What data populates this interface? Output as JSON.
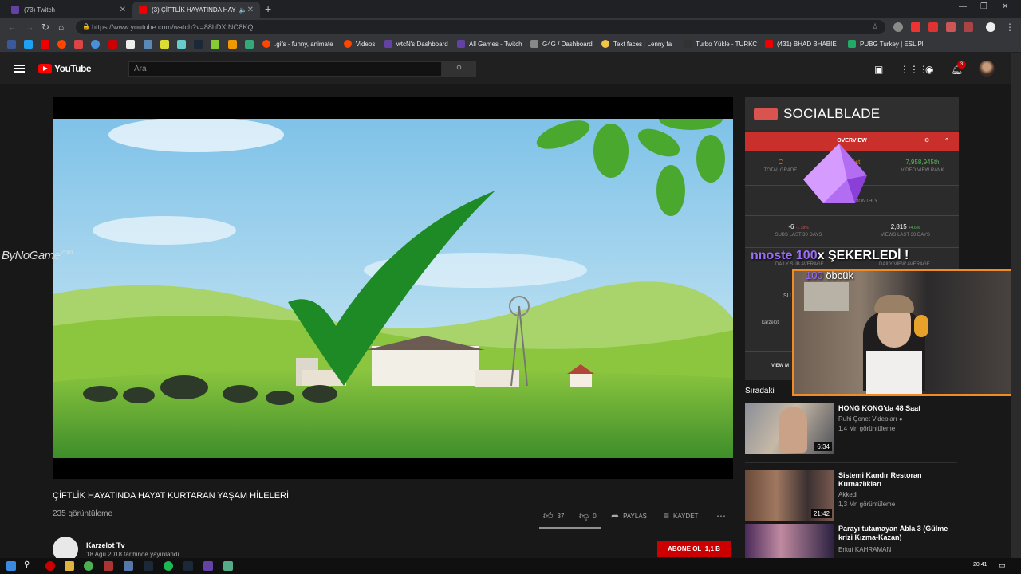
{
  "browser": {
    "tabs": [
      {
        "label": "(73) Twitch"
      },
      {
        "label": "(3) ÇİFTLİK HAYATINDA HAY"
      }
    ],
    "url": "https://www.youtube.com/watch?v=88hDXtNO8KQ",
    "bookmarks": [
      ".gifs - funny, animate",
      "Videos",
      "wtcN's Dashboard",
      "All Games - Twitch",
      "G4G / Dashboard",
      "Text faces | Lenny fa",
      "Turbo Yükle - TURKC",
      "(431) BHAD BHABIE",
      "PUBG Turkey | ESL Pl"
    ]
  },
  "youtube": {
    "logo_text": "YouTube",
    "search_placeholder": "Ara",
    "notifications_count": "3"
  },
  "watermark": "ByNoGame",
  "watermark_sup": ".com",
  "video": {
    "title": "ÇİFTLİK HAYATINDA HAYAT KURTARAN YAŞAM HİLELERİ",
    "views": "235 görüntüleme",
    "likes": "37",
    "dislikes": "0",
    "share_label": "PAYLAŞ",
    "save_label": "KAYDET",
    "channel_name": "Karzelot Tv",
    "published": "18 Ağu 2018 tarihinde yayınlandı",
    "subscribe_label": "ABONE OL",
    "subscriber_count": "1,1 B"
  },
  "socialblade": {
    "title": "SOCIALBLADE",
    "tab": "OVERVIEW",
    "stats": [
      {
        "value": "C",
        "label": "TOTAL GRADE"
      },
      {
        "value": "...91st",
        "label": "...RANK"
      },
      {
        "value": "7,958,945th",
        "label": "VIDEO VIEW RANK"
      }
    ],
    "estimated_label": "ESTIMATED MONTHLY",
    "subs_30": {
      "value": "-6",
      "change": "-1.18%",
      "label": "SUBS LAST 30 DAYS"
    },
    "views_30": {
      "value": "2,815",
      "change": "+4.6%",
      "label": "VIEWS LAST 30 DAYS"
    },
    "daily_sub_avg": "DAILY SUB AVERAGE",
    "daily_view_avg": "DAILY VIEW AVERAGE",
    "partial_label": "SU",
    "user_label": "karzelot",
    "view_more": "VIEW M"
  },
  "overlay": {
    "ticker_user": "nnoste",
    "ticker_amount": "100",
    "ticker_text": "x ŞEKERLEDİ !",
    "ticker2_amount": "100",
    "ticker2_text": "öbcük"
  },
  "upnext": {
    "label": "Sıradaki",
    "items": [
      {
        "title": "HONG KONG'da 48 Saat",
        "channel": "Ruhi Çenet Videoları",
        "views": "1,4 Mn görüntüleme",
        "duration": "6:34"
      },
      {
        "title": "Sistemi Kandır Restoran Kurnazlıkları",
        "channel": "Akkedi",
        "views": "1,3 Mn görüntüleme",
        "duration": "21:42"
      },
      {
        "title": "Parayı tutamayan Abla 3 (Gülme krizi Kızma-Kazan)",
        "channel": "Erkut KAHRAMAN",
        "views": "",
        "duration": ""
      }
    ]
  },
  "taskbar": {
    "clock": "20:41"
  },
  "colors": {
    "accent_red": "#cc0000",
    "socialblade_red": "#c9302c",
    "webcam_border": "#f08c28"
  }
}
